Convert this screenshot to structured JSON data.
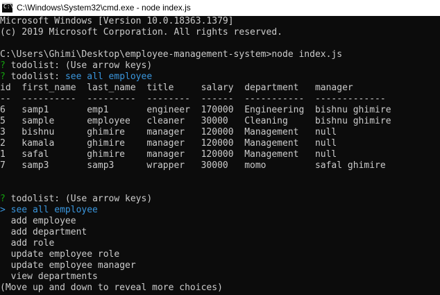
{
  "window": {
    "title": "C:\\Windows\\System32\\cmd.exe - node  index.js"
  },
  "console": {
    "lines": [
      "Microsoft Windows [Version 10.0.18363.1379]",
      "(c) 2019 Microsoft Corporation. All rights reserved.",
      "",
      "C:\\Users\\Ghimi\\Desktop\\employee-management-system>node index.js"
    ],
    "prompt_1": {
      "mark": "?",
      "label": "todolist:",
      "hint": " (Use arrow keys)"
    },
    "prompt_2": {
      "mark": "?",
      "label": "todolist:",
      "answer": "see all employee"
    },
    "table": {
      "header": "id  first_name  last_name  title     salary  department   manager",
      "divider": "--  ----------  ---------  --------  ------  -----------  -------------",
      "rows": [
        "6   samp1       emp1       engineer  170000  Engineering  bishnu ghimire",
        "5   sample      employee   cleaner   30000   Cleaning     bishnu ghimire",
        "3   bishnu      ghimire    manager   120000  Management   null",
        "2   kamala      ghimire    manager   120000  Management   null",
        "1   safal       ghimire    manager   120000  Management   null",
        "7   samp3       samp3      wrapper   30000   momo         safal ghimire"
      ]
    },
    "prompt_3": {
      "mark": "?",
      "label": "todolist:",
      "hint": " (Use arrow keys)"
    },
    "menu": {
      "selected_marker": "> ",
      "selected": "see all employee",
      "options": [
        "add employee",
        "add department",
        "add role",
        "update employee role",
        "update employee manager",
        "view departments"
      ]
    },
    "footer_hint": "(Move up and down to reveal more choices)"
  },
  "colors": {
    "background": "#0c0c0c",
    "foreground": "#cccccc",
    "prompt_green": "#13a10e",
    "highlight_cyan": "#3a96dd",
    "titlebar": "#ffffff"
  },
  "icons": {
    "window_icon": "cmd-icon"
  }
}
